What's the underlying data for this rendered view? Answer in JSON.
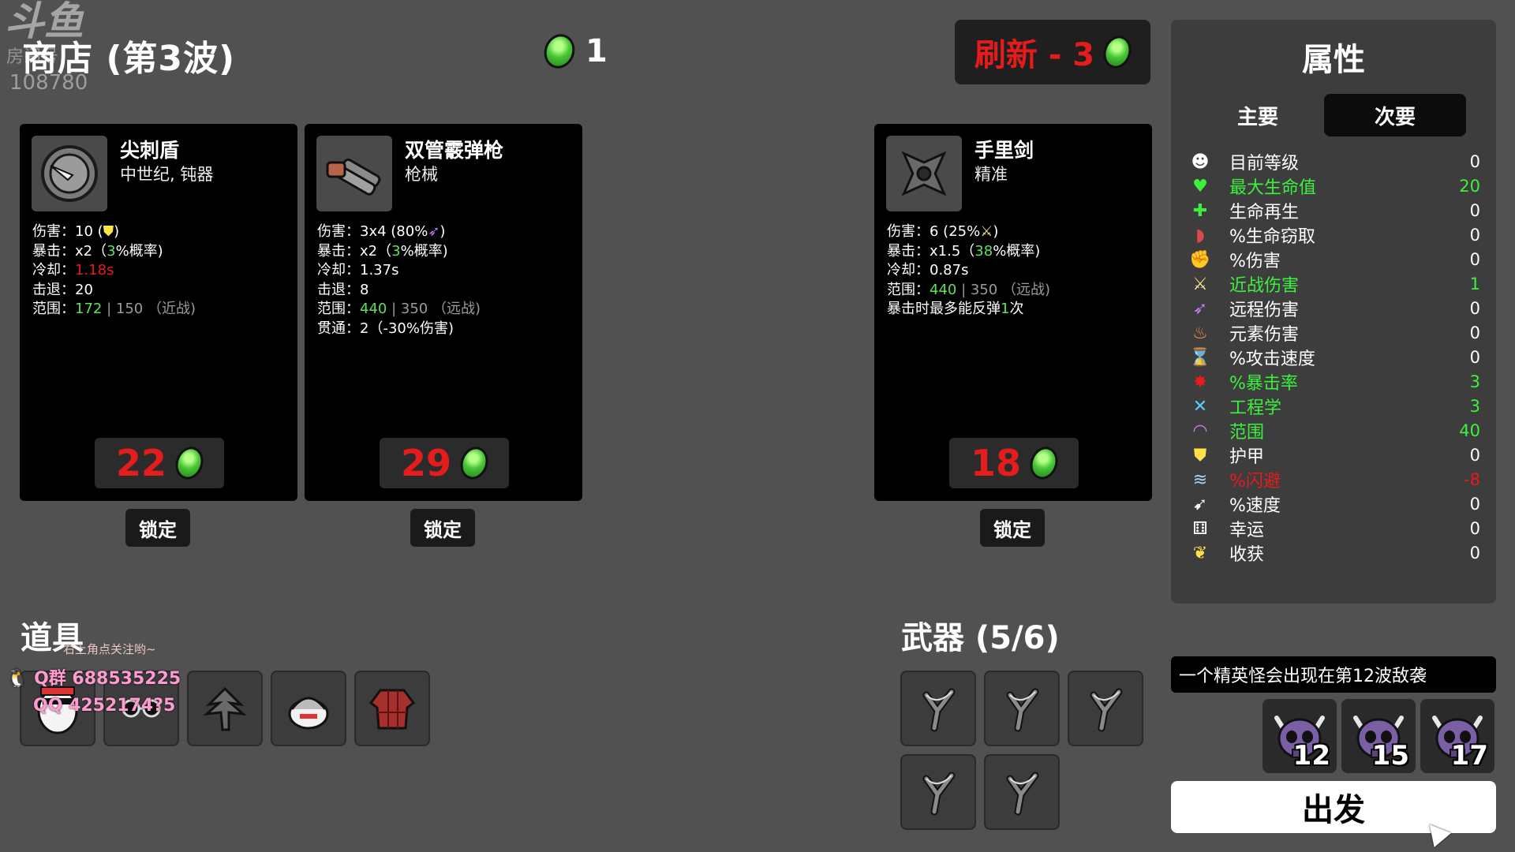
{
  "overlay": {
    "watermark_logo": "斗鱼",
    "watermark_sub": "房间号",
    "room_number": "108780",
    "stream_note": "右上角点关注哟~",
    "qq_group": "Q群 688535225",
    "qq_number": "QQ 4252174?5"
  },
  "header": {
    "shop_title": "商店 (第3波)",
    "materials": "1",
    "refresh_label": "刷新 - 3"
  },
  "shop": [
    {
      "name": "尖刺盾",
      "type": "中世纪, 钝器",
      "icon": "spiked-shield-icon",
      "stats": [
        {
          "label": "伤害：",
          "value": "10 (",
          "extra": ")",
          "icon": "armor-icon"
        },
        {
          "label": "暴击：",
          "value": "x2（",
          "hl": "3",
          "rest": "%概率)"
        },
        {
          "label": "冷却：",
          "value": "",
          "red": "1.18s"
        },
        {
          "label": "击退：",
          "value": "20"
        },
        {
          "label": "范围：",
          "green": "172",
          "rest": " | 150 （近战)"
        }
      ],
      "price": "22",
      "lock": "锁定"
    },
    {
      "name": "双管霰弹枪",
      "type": "枪械",
      "icon": "double-barrel-shotgun-icon",
      "stats": [
        {
          "label": "伤害：",
          "value": "3x4 (80%",
          "extra": ")",
          "icon": "ranged-damage-icon"
        },
        {
          "label": "暴击：",
          "value": "x2（",
          "hl": "3",
          "rest": "%概率)"
        },
        {
          "label": "冷却：",
          "value": "1.37s"
        },
        {
          "label": "击退：",
          "value": "8"
        },
        {
          "label": "范围：",
          "green": "440",
          "rest": " | 350 （远战)"
        },
        {
          "label": "贯通：",
          "value": "2（-30%伤害)"
        }
      ],
      "price": "29",
      "lock": "锁定"
    },
    {
      "name": "手里剑",
      "type": "精准",
      "icon": "shuriken-icon",
      "stats": [
        {
          "label": "伤害：",
          "value": "6 (25%",
          "extra": ")",
          "icon": "melee-damage-icon"
        },
        {
          "label": "暴击：",
          "value": "x1.5（",
          "hl": "38",
          "rest": "%概率)"
        },
        {
          "label": "冷却：",
          "value": "0.87s"
        },
        {
          "label": "范围：",
          "green": "440",
          "rest": " | 350 （远战)"
        },
        {
          "label": "",
          "value": "暴击时最多能反弹",
          "hl": "1",
          "rest": "次"
        }
      ],
      "price": "18",
      "lock": "锁定"
    }
  ],
  "items": {
    "title": "道具",
    "slots": [
      "mask-item-icon",
      "glasses-item-icon",
      "tree-item-icon",
      "helmet-item-icon",
      "plaid-shirt-item-icon"
    ]
  },
  "weapons": {
    "title": "武器 (5/6)",
    "slots": [
      "slingshot-icon",
      "slingshot-icon",
      "slingshot-icon",
      "slingshot-icon",
      "slingshot-icon"
    ]
  },
  "panel": {
    "title": "属性",
    "tab_primary": "主要",
    "tab_secondary": "次要",
    "rows": [
      {
        "name": "目前等级",
        "value": "0",
        "color": "white",
        "icon": "level-icon",
        "glyph": "☻",
        "glyph_color": "#ffffff"
      },
      {
        "name": "最大生命值",
        "value": "20",
        "color": "green",
        "icon": "heart-icon",
        "glyph": "♥",
        "glyph_color": "#3ef03e"
      },
      {
        "name": "生命再生",
        "value": "0",
        "color": "white",
        "icon": "regen-icon",
        "glyph": "✚",
        "glyph_color": "#3ef03e"
      },
      {
        "name": "%生命窃取",
        "value": "0",
        "color": "white",
        "icon": "lifesteal-icon",
        "glyph": "◗",
        "glyph_color": "#d94a4a"
      },
      {
        "name": "%伤害",
        "value": "0",
        "color": "white",
        "icon": "damage-icon",
        "glyph": "✊",
        "glyph_color": "#e57373"
      },
      {
        "name": "近战伤害",
        "value": "1",
        "color": "green",
        "icon": "melee-damage-icon",
        "glyph": "⚔",
        "glyph_color": "#f0e68c"
      },
      {
        "name": "远程伤害",
        "value": "0",
        "color": "white",
        "icon": "ranged-damage-icon",
        "glyph": "➶",
        "glyph_color": "#c77dff"
      },
      {
        "name": "元素伤害",
        "value": "0",
        "color": "white",
        "icon": "elemental-damage-icon",
        "glyph": "♨",
        "glyph_color": "#ff8a50"
      },
      {
        "name": "%攻击速度",
        "value": "0",
        "color": "white",
        "icon": "attack-speed-icon",
        "glyph": "⌛",
        "glyph_color": "#ffffff"
      },
      {
        "name": "%暴击率",
        "value": "3",
        "color": "green",
        "icon": "crit-chance-icon",
        "glyph": "✸",
        "glyph_color": "#e41c1c"
      },
      {
        "name": "工程学",
        "value": "3",
        "color": "green",
        "icon": "engineering-icon",
        "glyph": "✕",
        "glyph_color": "#5ecbff"
      },
      {
        "name": "范围",
        "value": "40",
        "color": "green",
        "icon": "range-icon",
        "glyph": "◠",
        "glyph_color": "#c77dff"
      },
      {
        "name": "护甲",
        "value": "0",
        "color": "white",
        "icon": "armor-icon",
        "glyph": "⛊",
        "glyph_color": "#ffe14a"
      },
      {
        "name": "%闪避",
        "value": "-8",
        "color": "red",
        "icon": "dodge-icon",
        "glyph": "≋",
        "glyph_color": "#9fd8ff"
      },
      {
        "name": "%速度",
        "value": "0",
        "color": "white",
        "icon": "speed-icon",
        "glyph": "➹",
        "glyph_color": "#ffffff"
      },
      {
        "name": "幸运",
        "value": "0",
        "color": "white",
        "icon": "luck-icon",
        "glyph": "⚅",
        "glyph_color": "#ffffff"
      },
      {
        "name": "收获",
        "value": "0",
        "color": "white",
        "icon": "harvesting-icon",
        "glyph": "❦",
        "glyph_color": "#ffe14a"
      }
    ]
  },
  "elite_notice": "一个精英怪会出现在第12波敌袭",
  "waves": [
    "12",
    "15",
    "17"
  ],
  "go_button": "出发"
}
